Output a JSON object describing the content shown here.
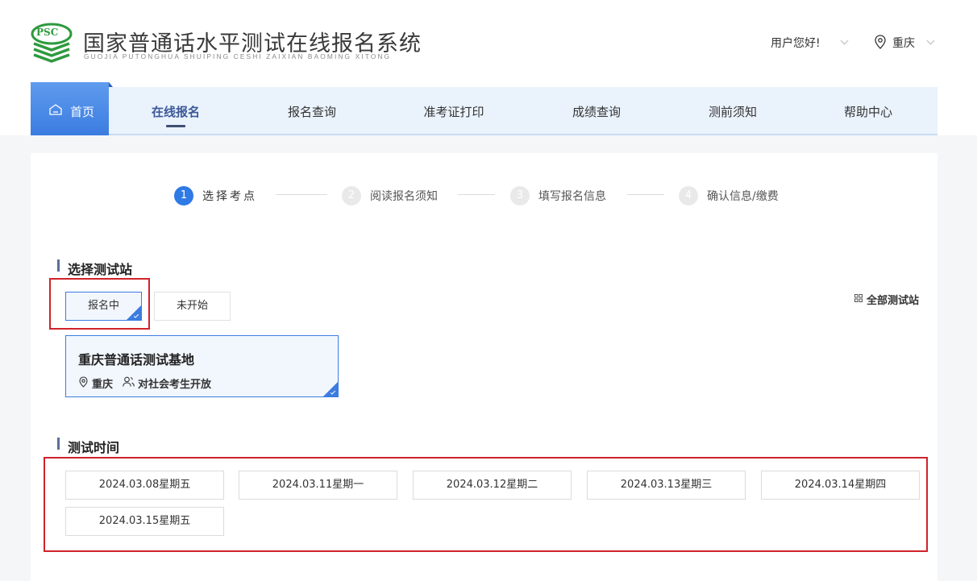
{
  "header": {
    "logo_text": "PSC",
    "title": "国家普通话水平测试在线报名系统",
    "subtitle": "GUOJIA PUTONGHUA SHUIPING CESHI ZAIXIAN BAOMING XITONG",
    "user_greeting": "用户您好!",
    "city": "重庆"
  },
  "nav": {
    "home": "首页",
    "items": [
      "在线报名",
      "报名查询",
      "准考证打印",
      "成绩查询",
      "测前须知",
      "帮助中心"
    ],
    "active_index": 0
  },
  "steps": [
    {
      "num": "1",
      "label": "选择考点",
      "active": true
    },
    {
      "num": "2",
      "label": "阅读报名须知",
      "active": false
    },
    {
      "num": "3",
      "label": "填写报名信息",
      "active": false
    },
    {
      "num": "4",
      "label": "确认信息/缴费",
      "active": false
    }
  ],
  "station_section": {
    "title": "选择测试站",
    "filters": [
      "报名中",
      "未开始"
    ],
    "selected_filter": "报名中",
    "all_stations_label": "全部测试站",
    "station": {
      "name": "重庆普通话测试基地",
      "city": "重庆",
      "audience": "对社会考生开放"
    }
  },
  "time_section": {
    "title": "测试时间",
    "dates": [
      "2024.03.08星期五",
      "2024.03.11星期一",
      "2024.03.12星期二",
      "2024.03.13星期三",
      "2024.03.14星期四",
      "2024.03.15星期五"
    ]
  },
  "colors": {
    "primary": "#3b7ce0",
    "highlight_box": "#d0222a",
    "logo_green": "#2e9a3e"
  }
}
